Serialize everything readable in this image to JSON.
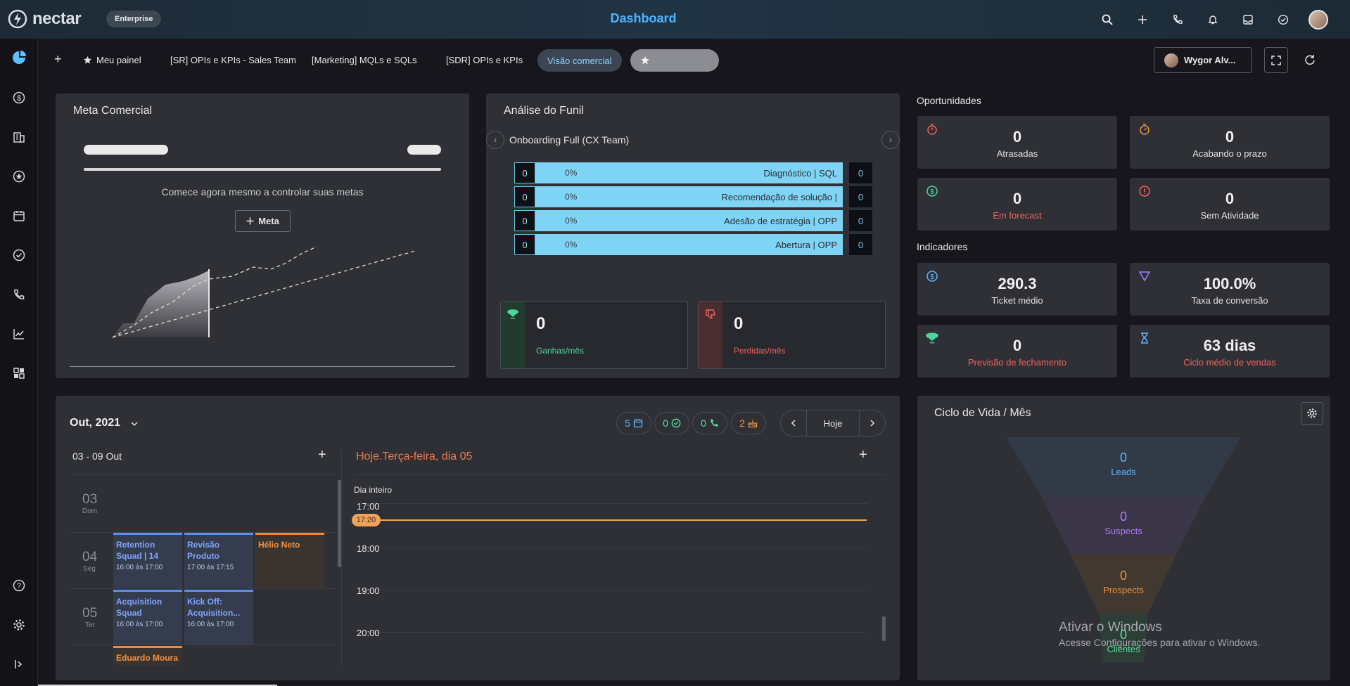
{
  "app": {
    "name": "nectar",
    "plan": "Enterprise",
    "title": "Dashboard"
  },
  "topbar": {
    "icons": [
      "search-icon",
      "add-icon",
      "phone-icon",
      "bell-icon",
      "inbox-icon",
      "check-circle-icon"
    ]
  },
  "sidebar": {
    "items": [
      "dashboard-icon",
      "money-icon",
      "company-icon",
      "star-icon",
      "calendar-icon",
      "task-icon",
      "call-icon",
      "reports-icon",
      "apps-icon"
    ],
    "bottom": [
      "help-icon",
      "settings-icon",
      "collapse-icon"
    ]
  },
  "tabs": {
    "add": "+",
    "items": [
      "Meu painel",
      "[SR] OPIs e KPIs - Sales Team",
      "[Marketing] MQLs e SQLs",
      "[SDR] OPIs e KPIs",
      "Visão comercial"
    ],
    "user": "Wygor Alv..."
  },
  "meta": {
    "title": "Meta Comercial",
    "message": "Comece agora mesmo a controlar suas metas",
    "button": "Meta"
  },
  "funil": {
    "title": "Análise do Funil",
    "pipeline": "Onboarding Full (CX Team)",
    "stages": [
      {
        "num": "0",
        "pct": "0%",
        "label": "Diagnóstico | SQL",
        "count": "0"
      },
      {
        "num": "0",
        "pct": "0%",
        "label": "Recomendação de solução |",
        "count": "0"
      },
      {
        "num": "0",
        "pct": "0%",
        "label": "Adesão de estratégia | OPP",
        "count": "0"
      },
      {
        "num": "0",
        "pct": "0%",
        "label": "Abertura | OPP",
        "count": "0"
      }
    ],
    "won": {
      "value": "0",
      "label": "Ganhas/mês"
    },
    "lost": {
      "value": "0",
      "label": "Perdidas/mês"
    }
  },
  "oportunidades": {
    "title": "Oportunidades",
    "items": [
      {
        "value": "0",
        "label": "Atrasadas",
        "color": "#e8e8ec"
      },
      {
        "value": "0",
        "label": "Acabando o prazo",
        "color": "#e8e8ec"
      },
      {
        "value": "0",
        "label": "Em forecast",
        "color": "#f0625a"
      },
      {
        "value": "0",
        "label": "Sem Atividade",
        "color": "#e8e8ec"
      }
    ]
  },
  "indicadores": {
    "title": "Indicadores",
    "items": [
      {
        "value": "290.3",
        "label": "Ticket médio",
        "color": "#e8e8ec"
      },
      {
        "value": "100.0%",
        "label": "Taxa de conversão",
        "color": "#e8e8ec"
      },
      {
        "value": "0",
        "label": "Previsão de fechamento",
        "color": "#f0625a"
      },
      {
        "value": "63 dias",
        "label": "Ciclo médio de vendas",
        "color": "#f0625a"
      }
    ]
  },
  "calendar": {
    "month": "Out, 2021",
    "counters": {
      "events": "5",
      "tasks": "0",
      "calls": "0",
      "birthdays": "2"
    },
    "today_btn": "Hoje",
    "week": "03 - 09 Out",
    "today_label": "Hoje.Terça-feira, dia 05",
    "all_day": "Dia inteiro",
    "now": "17:20",
    "hours": [
      "17:00",
      "18:00",
      "19:00",
      "20:00"
    ],
    "days": [
      {
        "num": "03",
        "name": "Dom"
      },
      {
        "num": "04",
        "name": "Seg"
      },
      {
        "num": "05",
        "name": "Ter"
      }
    ],
    "events": [
      {
        "title": "Retention Squad | 14",
        "time": "16:00 às 17:00"
      },
      {
        "title": "Revisão Produto",
        "time": "17:00 às 17:15"
      },
      {
        "title": "Hélio Neto",
        "time": ""
      },
      {
        "title": "Acquisition Squad",
        "time": "16:00 às 17:00"
      },
      {
        "title": "Kick Off: Acquisition...",
        "time": "16:00 às 17:00"
      },
      {
        "title": "Eduardo Moura",
        "time": ""
      }
    ]
  },
  "lifecycle": {
    "title": "Ciclo de Vida / Mês",
    "stages": [
      {
        "value": "0",
        "label": "Leads",
        "color": "#5cb6ff"
      },
      {
        "value": "0",
        "label": "Suspects",
        "color": "#b07bff"
      },
      {
        "value": "0",
        "label": "Prospects",
        "color": "#f09440"
      },
      {
        "value": "0",
        "label": "Clientes",
        "color": "#5ee0a0"
      }
    ]
  },
  "watermark": {
    "line1": "Ativar o Windows",
    "line2": "Acesse Configurações para ativar o Windows."
  }
}
